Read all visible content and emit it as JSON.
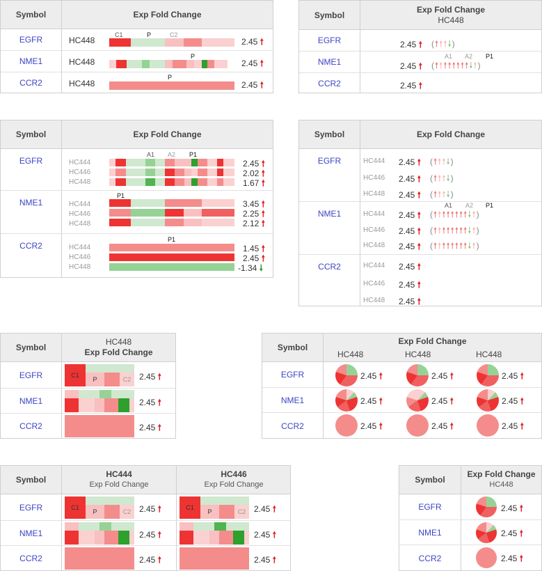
{
  "headers": {
    "symbol": "Symbol",
    "exp": "Exp Fold Change",
    "hc448": "HC448",
    "hc444": "HC444",
    "hc446": "HC446"
  },
  "genes": [
    "EGFR",
    "NME1",
    "CCR2"
  ],
  "samples": [
    "HC444",
    "HC446",
    "HC448"
  ],
  "markers": {
    "c1": "C1",
    "c2": "C2",
    "p": "P",
    "a1": "A1",
    "a2": "A2",
    "p1": "P1"
  },
  "values": {
    "v245": "2.45",
    "v202": "2.02",
    "v167": "1.67",
    "v345": "3.45",
    "v225": "2.25",
    "v212": "2.12",
    "v145": "1.45",
    "vneg134": "-1.34"
  },
  "arrows": {
    "up": "🠕",
    "down": "🠗",
    "open": "(",
    "close": ")"
  },
  "colors": {
    "red": "#ee3333",
    "red_mid": "#f48c8c",
    "red_light": "#fbd0d0",
    "green": "#2da02d",
    "green_mid": "#96d296",
    "green_light": "#cfe8cf"
  }
}
